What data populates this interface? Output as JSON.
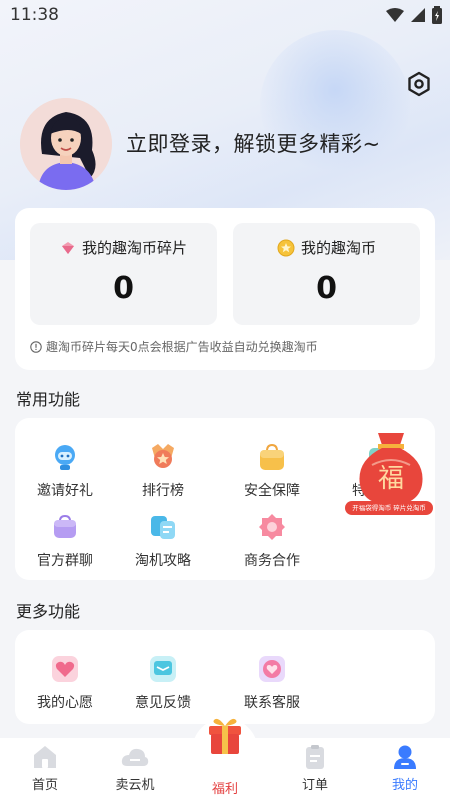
{
  "status": {
    "time": "11:38"
  },
  "header": {
    "login_prompt": "立即登录，解锁更多精彩~"
  },
  "wallet": {
    "fragments_label": "我的趣淘币碎片",
    "fragments_value": "0",
    "coins_label": "我的趣淘币",
    "coins_value": "0",
    "note": "趣淘币碎片每天0点会根据广告收益自动兑换趣淘币"
  },
  "common": {
    "title": "常用功能",
    "items": [
      {
        "label": "邀请好礼",
        "icon": "customer-service-icon"
      },
      {
        "label": "排行榜",
        "icon": "ranking-medal-icon"
      },
      {
        "label": "安全保障",
        "icon": "security-bag-icon"
      },
      {
        "label": "特惠商品",
        "icon": "discount-goods-icon"
      },
      {
        "label": "官方群聊",
        "icon": "group-chat-icon"
      },
      {
        "label": "淘机攻略",
        "icon": "guide-icon"
      },
      {
        "label": "商务合作",
        "icon": "cooperation-icon"
      }
    ],
    "promo_text": "开福袋得淘币 碎片兑淘币",
    "promo_char": "福"
  },
  "more": {
    "title": "更多功能",
    "items": [
      {
        "label": "我的心愿",
        "icon": "heart-icon"
      },
      {
        "label": "意见反馈",
        "icon": "feedback-icon"
      },
      {
        "label": "联系客服",
        "icon": "support-icon"
      }
    ]
  },
  "tabbar": {
    "items": [
      {
        "label": "首页"
      },
      {
        "label": "卖云机"
      },
      {
        "label": "福利"
      },
      {
        "label": "订单"
      },
      {
        "label": "我的"
      }
    ]
  },
  "colors": {
    "accent": "#3a7bff",
    "welfare": "#e44040"
  }
}
